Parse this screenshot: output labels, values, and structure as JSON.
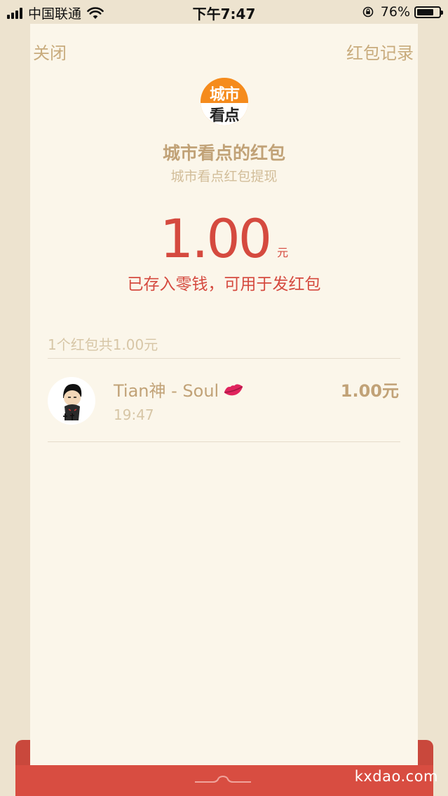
{
  "status_bar": {
    "carrier": "中国联通",
    "time": "下午7:47",
    "battery": "76%",
    "battery_level": 0.76
  },
  "nav": {
    "close": "关闭",
    "record": "红包记录"
  },
  "logo": {
    "line1": "城市",
    "line2": "看点"
  },
  "sender": {
    "title": "城市看点的红包",
    "subtitle": "城市看点红包提现"
  },
  "amount": {
    "value": "1.00",
    "unit": "元"
  },
  "saved_note": "已存入零钱，可用于发红包",
  "summary": "1个红包共1.00元",
  "records": [
    {
      "name": "Tian神 - Soul",
      "icon": "lips-icon",
      "time": "19:47",
      "amount": "1.00元"
    }
  ],
  "watermark": "kxdao.com",
  "colors": {
    "accent_red": "#d54a3f",
    "gold": "#c1a277",
    "card_bg": "#fbf6ea",
    "envelope_red": "#d84d41"
  }
}
